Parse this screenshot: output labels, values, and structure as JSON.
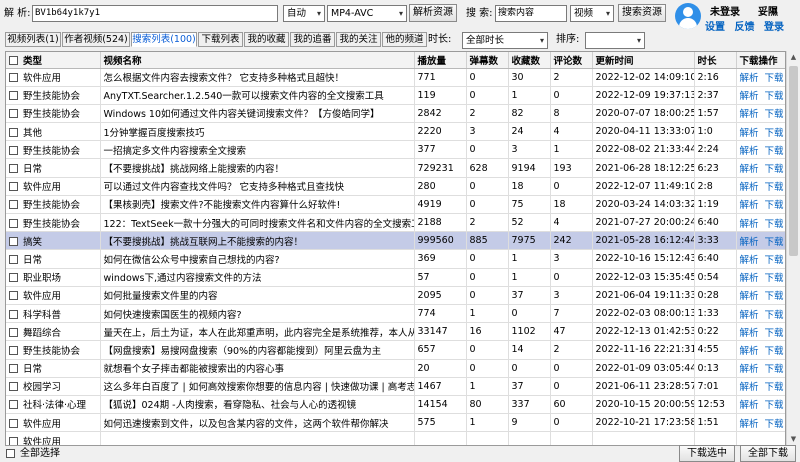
{
  "topbar": {
    "parse_label": "解 析:",
    "url_value": "BV1b64y1k7y1",
    "mode_select": "自动",
    "format_select": "MP4-AVC",
    "parse_button": "解析资源",
    "search_label": "搜 索:",
    "search_value": "搜索内容",
    "search_scope": "视频",
    "search_button": "搜索资源"
  },
  "user": {
    "status": "未登录",
    "plan": "妥隰",
    "links": [
      "设置",
      "反馈",
      "登录"
    ]
  },
  "tabs": [
    "视频列表(1)",
    "作者视频(524)",
    "搜索列表(100)",
    "下载列表",
    "我的收藏",
    "我的追番",
    "我的关注",
    "他的频道"
  ],
  "filters": {
    "duration_label": "时长:",
    "duration_value": "全部时长",
    "sort_label": "排序:",
    "sort_value": ""
  },
  "table": {
    "headers": [
      "类型",
      "视频名称",
      "播放量",
      "弹幕数",
      "收藏数",
      "评论数",
      "更新时间",
      "时长",
      "下载操作"
    ],
    "action_parse": "解析",
    "action_download": "下载",
    "rows": [
      [
        "软件应用",
        "怎么根据文件内容去搜索文件？ 它支持多种格式且超快！",
        "771",
        "0",
        "30",
        "2",
        "2022-12-02 14:09:10",
        "2:16"
      ],
      [
        "野生技能协会",
        "AnyTXT.Searcher.1.2.540一款可以搜索文件内容的全文搜索工具",
        "119",
        "0",
        "1",
        "0",
        "2022-12-09 19:37:13",
        "2:37"
      ],
      [
        "野生技能协会",
        "Windows 10如何通过文件内容关键词搜索文件？【方俊皓同学】",
        "2842",
        "2",
        "82",
        "8",
        "2020-07-07 18:00:25",
        "1:57"
      ],
      [
        "其他",
        "1分钟掌握百度搜索技巧",
        "2220",
        "3",
        "24",
        "4",
        "2020-04-11 13:33:07",
        "1:0"
      ],
      [
        "野生技能协会",
        "一招搞定多文件内容搜索全文搜索",
        "377",
        "0",
        "3",
        "1",
        "2022-08-02 21:33:44",
        "2:24"
      ],
      [
        "日常",
        "【不要搜挑战】挑战网络上能搜索的内容！",
        "729231",
        "628",
        "9194",
        "193",
        "2021-06-28 18:12:25",
        "6:23"
      ],
      [
        "软件应用",
        "可以通过文件内容查找文件吗？ 它支持多种格式且查找快",
        "280",
        "0",
        "18",
        "0",
        "2022-12-07 11:49:10",
        "2:8"
      ],
      [
        "野生技能协会",
        "【果核剥壳】搜索文件?不能搜索文件内容算什么好软件!",
        "4919",
        "0",
        "75",
        "18",
        "2020-03-24 14:03:32",
        "1:19"
      ],
      [
        "野生技能协会",
        "122：TextSeek一款十分强大的可同时搜索文件名和文件内容的全文搜索工具",
        "2188",
        "2",
        "52",
        "4",
        "2021-07-27 20:00:24",
        "6:40"
      ],
      [
        "搞笑",
        "【不要搜挑战】挑战互联网上不能搜索的内容！",
        "999560",
        "885",
        "7975",
        "242",
        "2021-05-28 16:12:44",
        "3:33"
      ],
      [
        "日常",
        "如何在微信公众号中搜索自己想找的内容?",
        "369",
        "0",
        "1",
        "3",
        "2022-10-16 15:12:43",
        "6:40"
      ],
      [
        "职业职场",
        "windows下,通过内容搜索文件的方法",
        "57",
        "0",
        "1",
        "0",
        "2022-12-03 15:35:45",
        "0:54"
      ],
      [
        "软件应用",
        "如何批量搜索文件里的内容",
        "2095",
        "0",
        "37",
        "3",
        "2021-06-04 19:11:33",
        "0:28"
      ],
      [
        "科学科普",
        "如何快速搜索国医生的视频内容?",
        "774",
        "1",
        "0",
        "7",
        "2022-02-03 08:00:13",
        "1:33"
      ],
      [
        "舞蹈综合",
        "量天在上，后土为证，本人在此郑重声明，此内容完全是系统推荐，本人从来没有搜索过",
        "33147",
        "16",
        "1102",
        "47",
        "2022-12-13 01:42:53",
        "0:22"
      ],
      [
        "野生技能协会",
        "【网盘搜索】易搜网盘搜索（90%的内容都能搜到）阿里云盘为主",
        "657",
        "0",
        "14",
        "2",
        "2022-11-16 22:21:31",
        "4:55"
      ],
      [
        "日常",
        "就想看个女子摔击都能被搜索出的内容心事",
        "20",
        "0",
        "0",
        "0",
        "2022-01-09 03:05:44",
        "0:13"
      ],
      [
        "校园学习",
        "这么多年白百度了 | 如何高效搜索你想要的信息内容 | 快速做功课 | 高考志愿填报",
        "1467",
        "1",
        "37",
        "0",
        "2021-06-11 23:28:57",
        "7:01"
      ],
      [
        "社科·法律·心理",
        "【狐说】024期 -人肉搜索，看穿隐私、社会与人心的透视镜",
        "14154",
        "80",
        "337",
        "60",
        "2020-10-15 20:00:59",
        "12:53"
      ],
      [
        "软件应用",
        "如何迅速搜索到文件，以及包含某内容的文件，这两个软件帮你解决",
        "575",
        "1",
        "9",
        "0",
        "2022-10-21 17:23:58",
        "1:51"
      ],
      [
        "软件应用",
        "",
        "",
        "",
        "",
        "",
        "",
        ""
      ]
    ]
  },
  "selected_row": 9,
  "bottom": {
    "select_all": "全部选择",
    "download_selected": "下载选中",
    "download_all": "全部下载"
  }
}
